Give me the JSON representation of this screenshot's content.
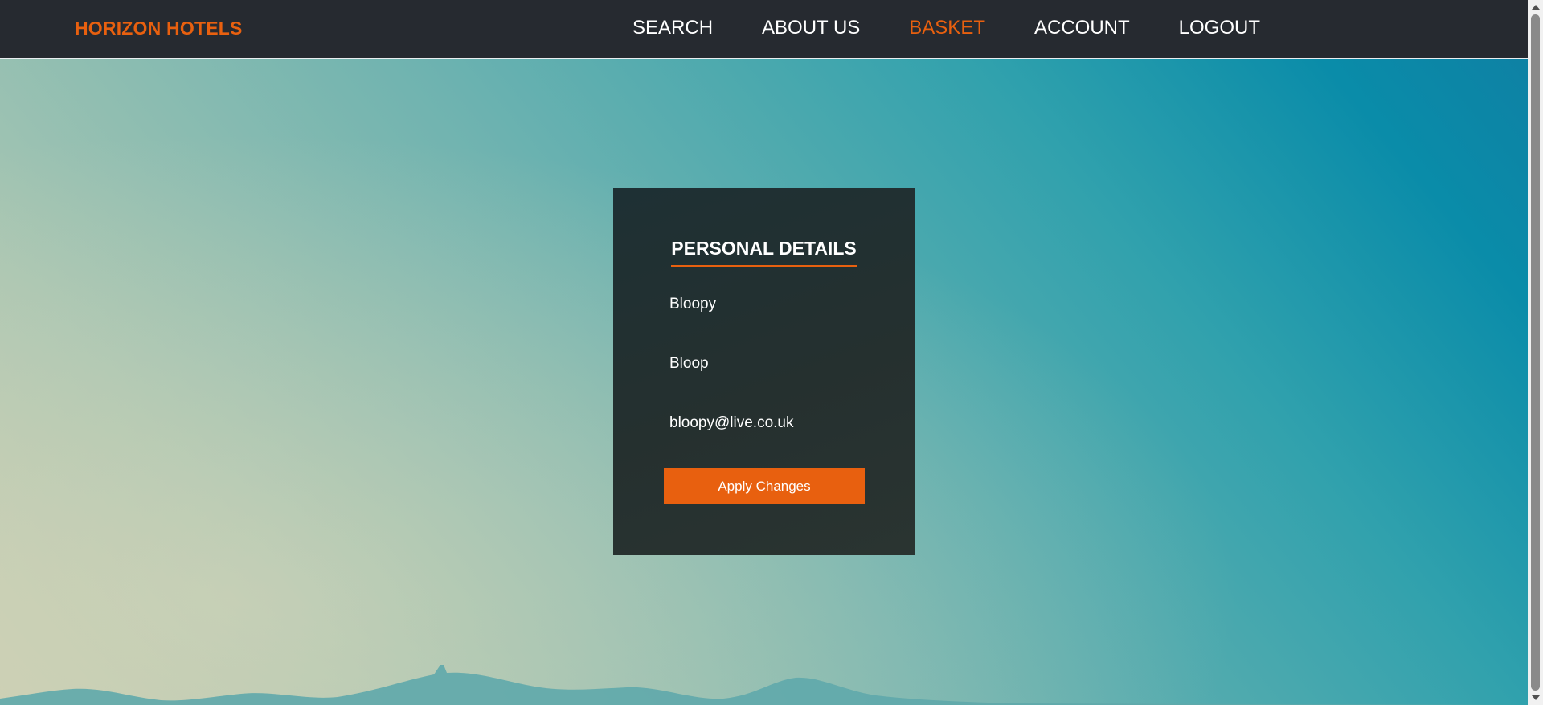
{
  "brand": {
    "name": "HORIZON HOTELS"
  },
  "nav": {
    "items": [
      {
        "label": "SEARCH",
        "active": false
      },
      {
        "label": "ABOUT US",
        "active": false
      },
      {
        "label": "BASKET",
        "active": true
      },
      {
        "label": "ACCOUNT",
        "active": false
      },
      {
        "label": "LOGOUT",
        "active": false
      }
    ]
  },
  "personal_details": {
    "title": "PERSONAL DETAILS",
    "first_name": "Bloopy",
    "last_name": "Bloop",
    "email": "bloopy@live.co.uk",
    "apply_label": "Apply Changes"
  },
  "colors": {
    "accent": "#e8600f",
    "navbar_bg": "#262a30",
    "card_bg": "#25302f"
  },
  "icons": {
    "scroll_up": "chevron-up-icon",
    "scroll_down": "chevron-down-icon"
  }
}
